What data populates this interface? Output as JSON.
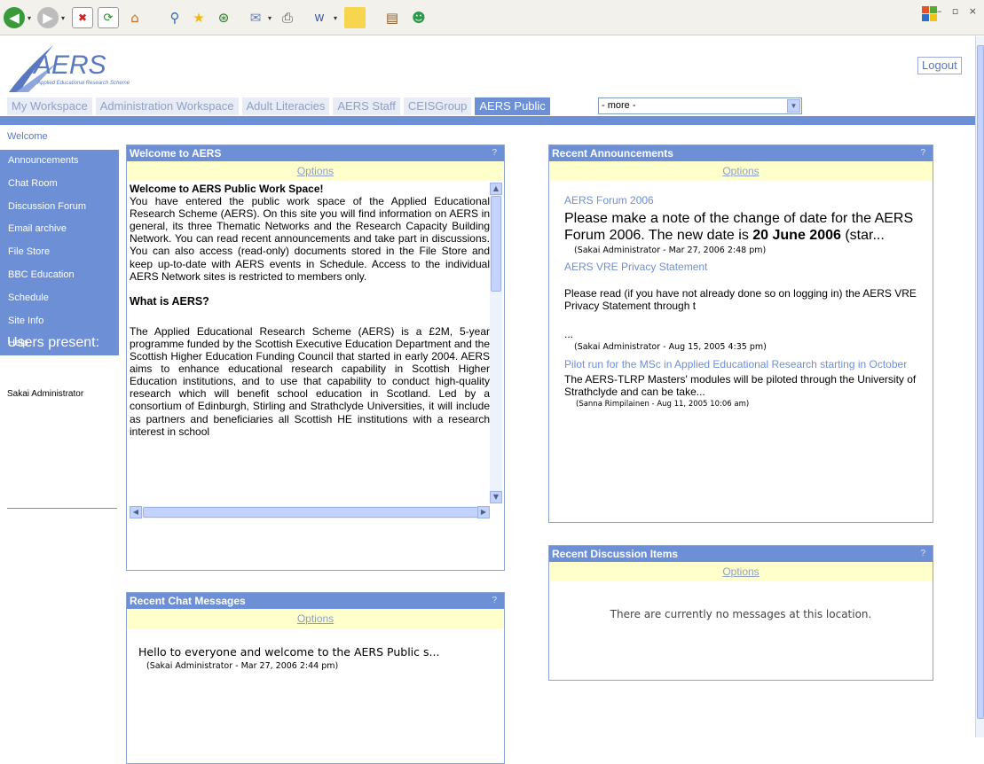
{
  "browser": {
    "toolbar_icons": [
      "back-icon",
      "forward-icon",
      "stop-icon",
      "refresh-icon",
      "home-icon",
      "search-icon",
      "favorites-icon",
      "history-icon",
      "mail-icon",
      "print-icon",
      "edit-icon",
      "notes-icon",
      "research-icon",
      "messenger-icon"
    ],
    "window_controls": "– ▫ ×"
  },
  "site": {
    "logo_text": "AERS",
    "logo_subtitle": "Applied Educational Research Scheme",
    "logout": "Logout",
    "tabs": [
      {
        "label": "My Workspace",
        "active": false
      },
      {
        "label": "Administration Workspace",
        "active": false
      },
      {
        "label": "Adult Literacies",
        "active": false
      },
      {
        "label": "AERS Staff",
        "active": false
      },
      {
        "label": "CEISGroup",
        "active": false
      },
      {
        "label": "AERS Public",
        "active": true
      }
    ],
    "more_select": "- more -"
  },
  "sidebar": {
    "welcome": "Welcome",
    "items": [
      {
        "label": "Announcements"
      },
      {
        "label": "Chat Room"
      },
      {
        "label": "Discussion Forum"
      },
      {
        "label": "Email archive"
      },
      {
        "label": "File Store"
      },
      {
        "label": "BBC Education"
      },
      {
        "label": "Schedule"
      },
      {
        "label": "Site Info"
      },
      {
        "label": "Help"
      }
    ],
    "users_present_title": "Users present:",
    "users": [
      "Sakai Administrator"
    ]
  },
  "welcome_portlet": {
    "title": "Welcome to AERS",
    "help": "?",
    "options": "Options",
    "heading": "Welcome to AERS Public Work Space!",
    "intro": "You have entered the public work space of the Applied Educational Research Scheme (AERS). On this site you will find information on AERS in general, its three Thematic Networks and the Research Capacity Building Network. You can read recent announcements and take part in discussions. You can also access (read-only) documents stored in the File Store and keep up-to-date with AERS events in Schedule. Access to the individual AERS Network sites is restricted to members only.",
    "what_heading": "What is AERS?",
    "what_body": "The Applied Educational Research Scheme (AERS) is a £2M, 5-year programme funded by the Scottish Executive Education Department and the Scottish Higher Education Funding Council that started in early 2004. AERS aims to enhance educational research capability in Scottish Higher Education institutions, and to use that capability to conduct high-quality research which will benefit school education in Scotland. Led by a consortium of Edinburgh, Stirling and Strathclyde Universities, it will include as partners and beneficiaries all Scottish HE institutions with a research interest in school"
  },
  "announcements_portlet": {
    "title": "Recent Announcements",
    "help": "?",
    "options": "Options",
    "items": [
      {
        "title": "AERS Forum 2006",
        "body_prefix": "Please make a note of the change of date for the AERS Forum 2006. The new date is ",
        "body_bold": "20 June 2006",
        "body_suffix": " (star...",
        "meta": "(Sakai Administrator - Mar 27, 2006 2:48 pm)"
      },
      {
        "title": "AERS VRE Privacy Statement",
        "body": "Please read (if you have not already done so on logging in) the AERS VRE Privacy Statement through t",
        "ellipsis": "...",
        "meta": "(Sakai Administrator - Aug 15, 2005 4:35 pm)"
      },
      {
        "title": "Pilot run for the MSc in Applied Educational Research starting in October",
        "body": "The AERS-TLRP Masters' modules will be piloted through the University of Strathclyde and can be take...",
        "meta": "(Sanna Rimpilainen - Aug 11, 2005 10:06 am)"
      }
    ]
  },
  "chat_portlet": {
    "title": "Recent Chat Messages",
    "help": "?",
    "options": "Options",
    "message": "Hello to everyone and welcome to the AERS Public s...",
    "meta": "(Sakai Administrator - Mar 27, 2006 2:44 pm)"
  },
  "discussion_portlet": {
    "title": "Recent Discussion Items",
    "help": "?",
    "options": "Options",
    "empty": "There are currently no messages at this location."
  },
  "colors": {
    "accent": "#6d8fd6",
    "options_bg": "#ffffcc",
    "link": "#6d8fd6"
  }
}
